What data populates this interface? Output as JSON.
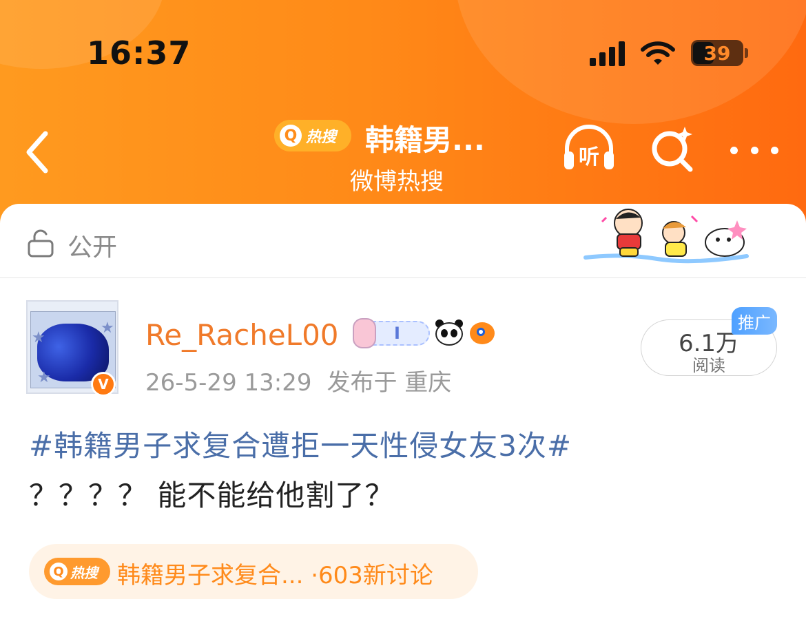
{
  "status_bar": {
    "time": "16:37",
    "battery": "39"
  },
  "nav": {
    "badge_label": "热搜",
    "title": "韩籍男...",
    "subtitle": "微博热搜",
    "listen_label": "听"
  },
  "visibility": {
    "label": "公开"
  },
  "post": {
    "username": "Re_RacheL00",
    "timestamp": "26-5-29 13:29",
    "published_at": "发布于 重庆",
    "read_count": "6.1万",
    "read_label": "阅读",
    "promo_label": "推广",
    "topic": "#韩籍男子求复合遭拒一天性侵女友3次#",
    "text": "？？？？ 能不能给他割了？",
    "verified_label": "V",
    "badge_letter": "I"
  },
  "hot_search": {
    "badge_label": "热搜",
    "text": "韩籍男子求复合... ·603新讨论"
  },
  "colors": {
    "brand_orange": "#ff8a18",
    "username": "#f07a2a",
    "topic_link": "#4a6ea8",
    "promo_blue": "#4ea0ff"
  },
  "icons": [
    "back-icon",
    "search-icon",
    "listen-icon",
    "more-icon",
    "lock-icon"
  ]
}
